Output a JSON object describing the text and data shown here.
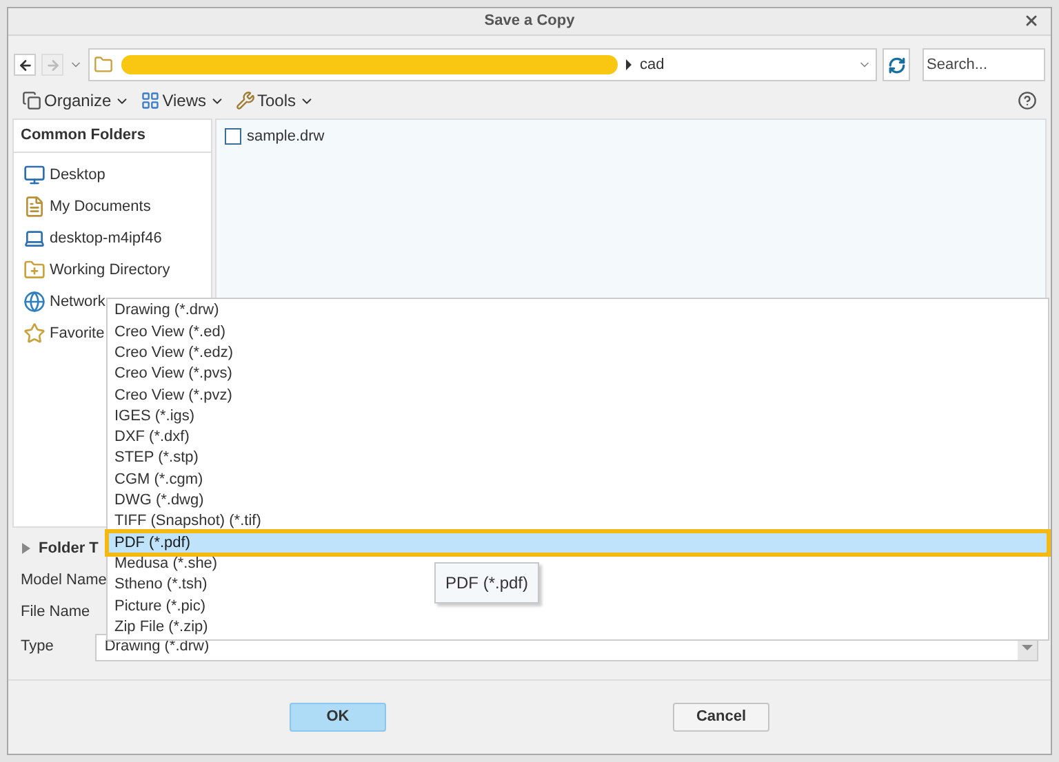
{
  "window": {
    "title": "Save a Copy"
  },
  "navigation": {
    "path": "cad",
    "search": {
      "placeholder": "Search..."
    }
  },
  "toolbar": [
    {
      "label": "Organize",
      "kind": "organize"
    },
    {
      "label": "Views",
      "kind": "views"
    },
    {
      "label": "Tools",
      "kind": "tools"
    }
  ],
  "sidebar": {
    "title": "Common Folders",
    "items": [
      {
        "label": "Desktop",
        "kind": "desktop"
      },
      {
        "label": "My Documents",
        "kind": "documents"
      },
      {
        "label": "desktop-m4ipf46",
        "kind": "computer"
      },
      {
        "label": "Working Directory",
        "kind": "folder"
      },
      {
        "label": "Network",
        "kind": "network"
      },
      {
        "label": "Favorite",
        "kind": "favorites"
      }
    ]
  },
  "files": [
    {
      "name": "sample.drw"
    }
  ],
  "folder_tree": {
    "label": "Folder T",
    "expanded": false
  },
  "fields": {
    "model_name": "Model Name",
    "file_name": "File Name",
    "type": "Type",
    "type_value": "Drawing (*.drw)"
  },
  "type_dropdown": {
    "expanded": true,
    "options": [
      {
        "label": "Drawing (*.drw)",
        "selected": false
      },
      {
        "label": "Creo View (*.ed)",
        "selected": false
      },
      {
        "label": "Creo View (*.edz)",
        "selected": false
      },
      {
        "label": "Creo View (*.pvs)",
        "selected": false
      },
      {
        "label": "Creo View (*.pvz)",
        "selected": false
      },
      {
        "label": "IGES (*.igs)",
        "selected": false
      },
      {
        "label": "DXF (*.dxf)",
        "selected": false
      },
      {
        "label": "STEP (*.stp)",
        "selected": false
      },
      {
        "label": "CGM (*.cgm)",
        "selected": false
      },
      {
        "label": "DWG (*.dwg)",
        "selected": false
      },
      {
        "label": "TIFF (Snapshot) (*.tif)",
        "selected": false
      },
      {
        "label": "PDF (*.pdf)",
        "selected": true
      },
      {
        "label": "Medusa (*.she)",
        "selected": false
      },
      {
        "label": "Stheno (*.tsh)",
        "selected": false
      },
      {
        "label": "Picture (*.pic)",
        "selected": false
      },
      {
        "label": "Zip File (*.zip)",
        "selected": false
      }
    ]
  },
  "tooltip": "PDF (*.pdf)",
  "buttons": [
    {
      "label": "OK",
      "default": true
    },
    {
      "label": "Cancel",
      "default": false
    }
  ]
}
